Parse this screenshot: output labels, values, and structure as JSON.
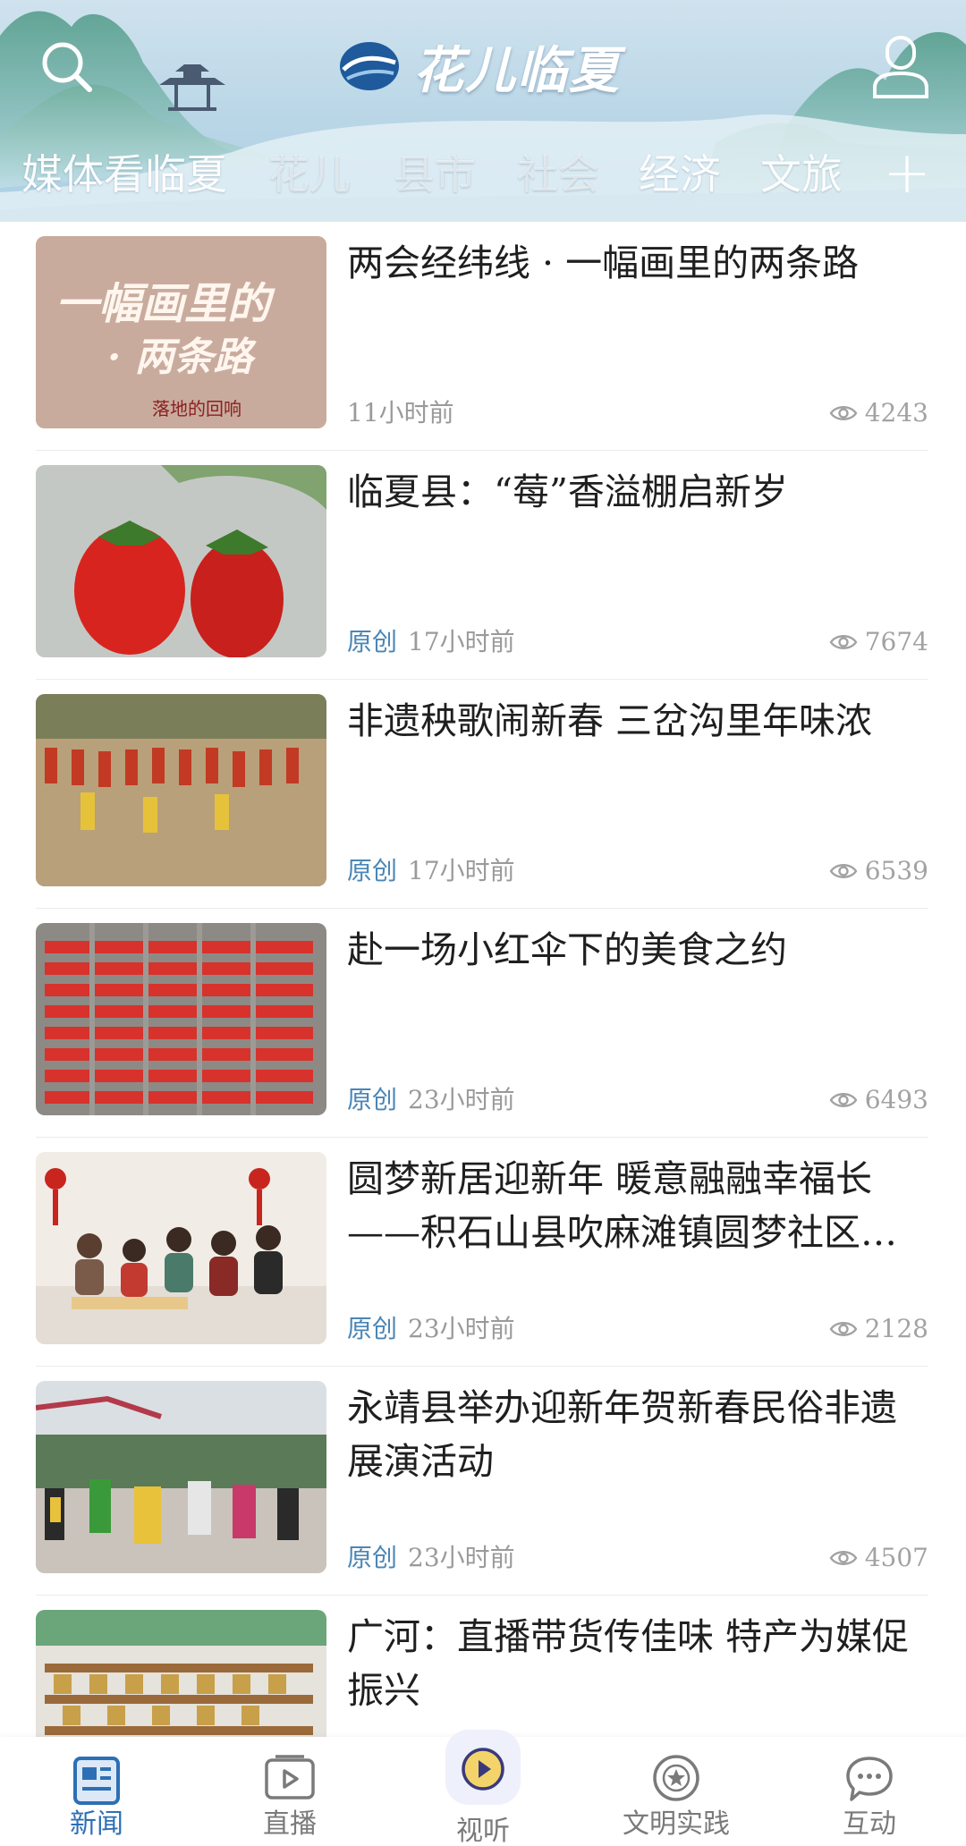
{
  "header": {
    "brand_title": "花儿临夏",
    "tabs": [
      {
        "label": "媒体看临夏",
        "state": "normal"
      },
      {
        "label": "花儿",
        "state": "dim"
      },
      {
        "label": "县市",
        "state": "dim"
      },
      {
        "label": "社会",
        "state": "dim"
      },
      {
        "label": "经济",
        "state": "normal"
      },
      {
        "label": "文旅",
        "state": "normal"
      }
    ],
    "plus_label": "+",
    "icons": {
      "search": "search-icon",
      "user": "user-icon",
      "logo": "brand-logo-icon",
      "views": "eye-icon"
    }
  },
  "news": [
    {
      "title": "两会经纬线 · 一幅画里的两条路",
      "source": "",
      "time": "11小时前",
      "views": "4243",
      "thumb": {
        "text_line1": "一幅画里的",
        "text_line2": "· 两条路",
        "small_text": "落地的回响"
      }
    },
    {
      "title": "临夏县：“莓”香溢棚启新岁",
      "source": "原创",
      "time": "17小时前",
      "views": "7674"
    },
    {
      "title": "非遗秧歌闹新春  三岔沟里年味浓",
      "source": "原创",
      "time": "17小时前",
      "views": "6539"
    },
    {
      "title": "赴一场小红伞下的美食之约",
      "source": "原创",
      "time": "23小时前",
      "views": "6493"
    },
    {
      "title": "圆梦新居迎新年  暖意融融幸福长——积石山县吹麻滩镇圆梦社区…",
      "source": "原创",
      "time": "23小时前",
      "views": "2128"
    },
    {
      "title": "永靖县举办迎新年贺新春民俗非遗展演活动",
      "source": "原创",
      "time": "23小时前",
      "views": "4507"
    },
    {
      "title": "广河：直播带货传佳味  特产为媒促振兴",
      "source": "",
      "time": "",
      "views": ""
    }
  ],
  "bottom_nav": [
    {
      "label": "新闻",
      "icon": "news-icon",
      "active": true
    },
    {
      "label": "直播",
      "icon": "live-icon",
      "active": false
    },
    {
      "label": "视听",
      "icon": "play-icon",
      "active": false
    },
    {
      "label": "文明实践",
      "icon": "civilization-badge-icon",
      "active": false
    },
    {
      "label": "互动",
      "icon": "chat-icon",
      "active": false
    }
  ],
  "colors": {
    "accent": "#2c6fb5",
    "source": "#4a86b6",
    "meta": "#9a9a9a",
    "header_sky": "#b9d6e6"
  }
}
